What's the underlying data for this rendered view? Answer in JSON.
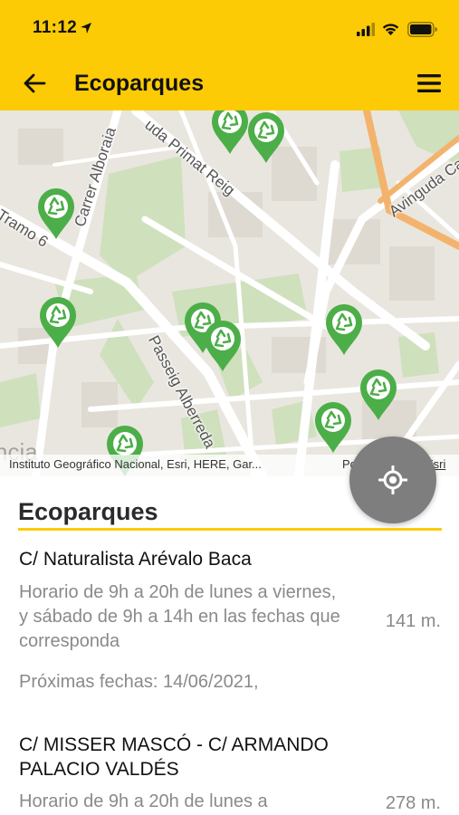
{
  "status": {
    "time": "11:12"
  },
  "header": {
    "title": "Ecoparques",
    "back_icon": "arrow-left-icon",
    "menu_icon": "hamburger-menu-icon"
  },
  "map": {
    "streets": {
      "alboraia": "Carrer Alboraia",
      "primat": "uda Primat Reig",
      "tramo": "Tramo 6",
      "passeig": "Passeig Alberreda",
      "avinguda": "Avinguda Ca"
    },
    "city_fragment": "ncia",
    "attribution": "Instituto Geográfico Nacional, Esri, HERE, Gar...",
    "attribution_right": "Po",
    "attribution_esri": "Esri",
    "pin_color": "#4cae48"
  },
  "list": {
    "title": "Ecoparques",
    "accent": "#fccb05",
    "items": [
      {
        "name": "C/ Naturalista Arévalo Baca",
        "desc": "Horario de 9h a 20h de lunes a viernes, y sábado de 9h a 14h en las fechas que corresponda",
        "distance": "141 m.",
        "dates": "Próximas fechas: 14/06/2021,"
      },
      {
        "name": "C/ MISSER MASCÓ - C/ ARMANDO PALACIO VALDÉS",
        "desc": "Horario de 9h a 20h de lunes a",
        "distance": "278 m."
      }
    ]
  }
}
